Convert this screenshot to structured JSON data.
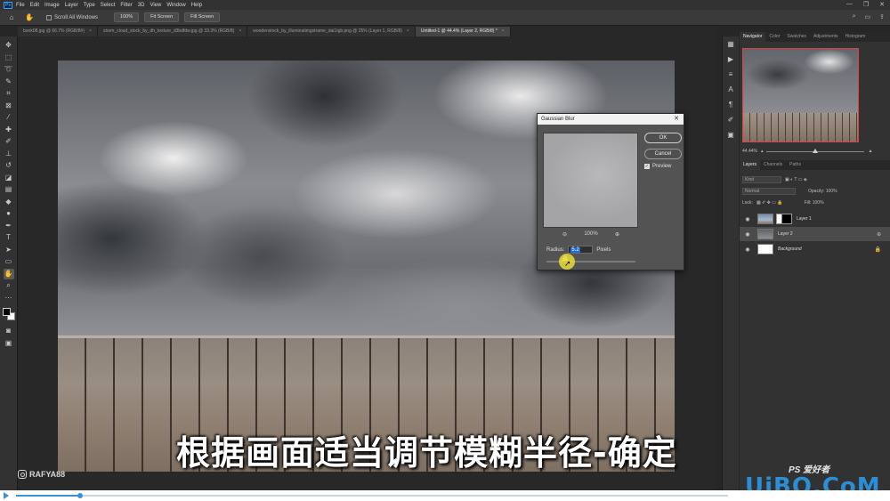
{
  "menu": [
    "File",
    "Edit",
    "Image",
    "Layer",
    "Type",
    "Select",
    "Filter",
    "3D",
    "View",
    "Window",
    "Help"
  ],
  "app_logo": "Ps",
  "options": {
    "scroll_all_windows": "Scroll All Windows",
    "zoom_100": "100%",
    "fit_screen": "Fit Screen",
    "fill_screen": "Fill Screen"
  },
  "tabs": [
    {
      "label": "book08.jpg @ 66.7% (RGB/8#)"
    },
    {
      "label": "storm_cloud_stock_by_dh_texture_d3bdfdw.jpg @ 33.3% (RGB/8)"
    },
    {
      "label": "woodenstock_by_illuminatimgstrame_dai1tgb.png @ 25% (Layer 1, RGB/8)"
    },
    {
      "label": "Untitled-1 @ 44.4% (Layer 2, RGB/8) *"
    }
  ],
  "dialog": {
    "title": "Gaussian Blur",
    "ok": "OK",
    "cancel": "Cancel",
    "preview": "Preview",
    "zoom": "100%",
    "radius_label": "Radius:",
    "radius_value": "5.2",
    "radius_unit": "Pixels"
  },
  "right_panel": {
    "nav_tabs": [
      "Navigator",
      "Color",
      "Swatches",
      "Adjustments",
      "Histogram"
    ],
    "nav_zoom": "44.44%",
    "layer_tabs": [
      "Layers",
      "Channels",
      "Paths"
    ],
    "kind": "Kind",
    "blend_mode": "Normal",
    "opacity": "Opacity: 100%",
    "lock": "Lock:",
    "fill": "Fill: 100%",
    "layers": [
      {
        "name": "Layer 1"
      },
      {
        "name": "Layer 2"
      },
      {
        "name": "Background"
      }
    ]
  },
  "watermark_left": "RAFYA88",
  "subtitle": "根据画面适当调节模糊半径-确定",
  "site_watermark": "UiBQ.CoM",
  "ps_watermark": "PS 爱好者",
  "progress": 0.09
}
